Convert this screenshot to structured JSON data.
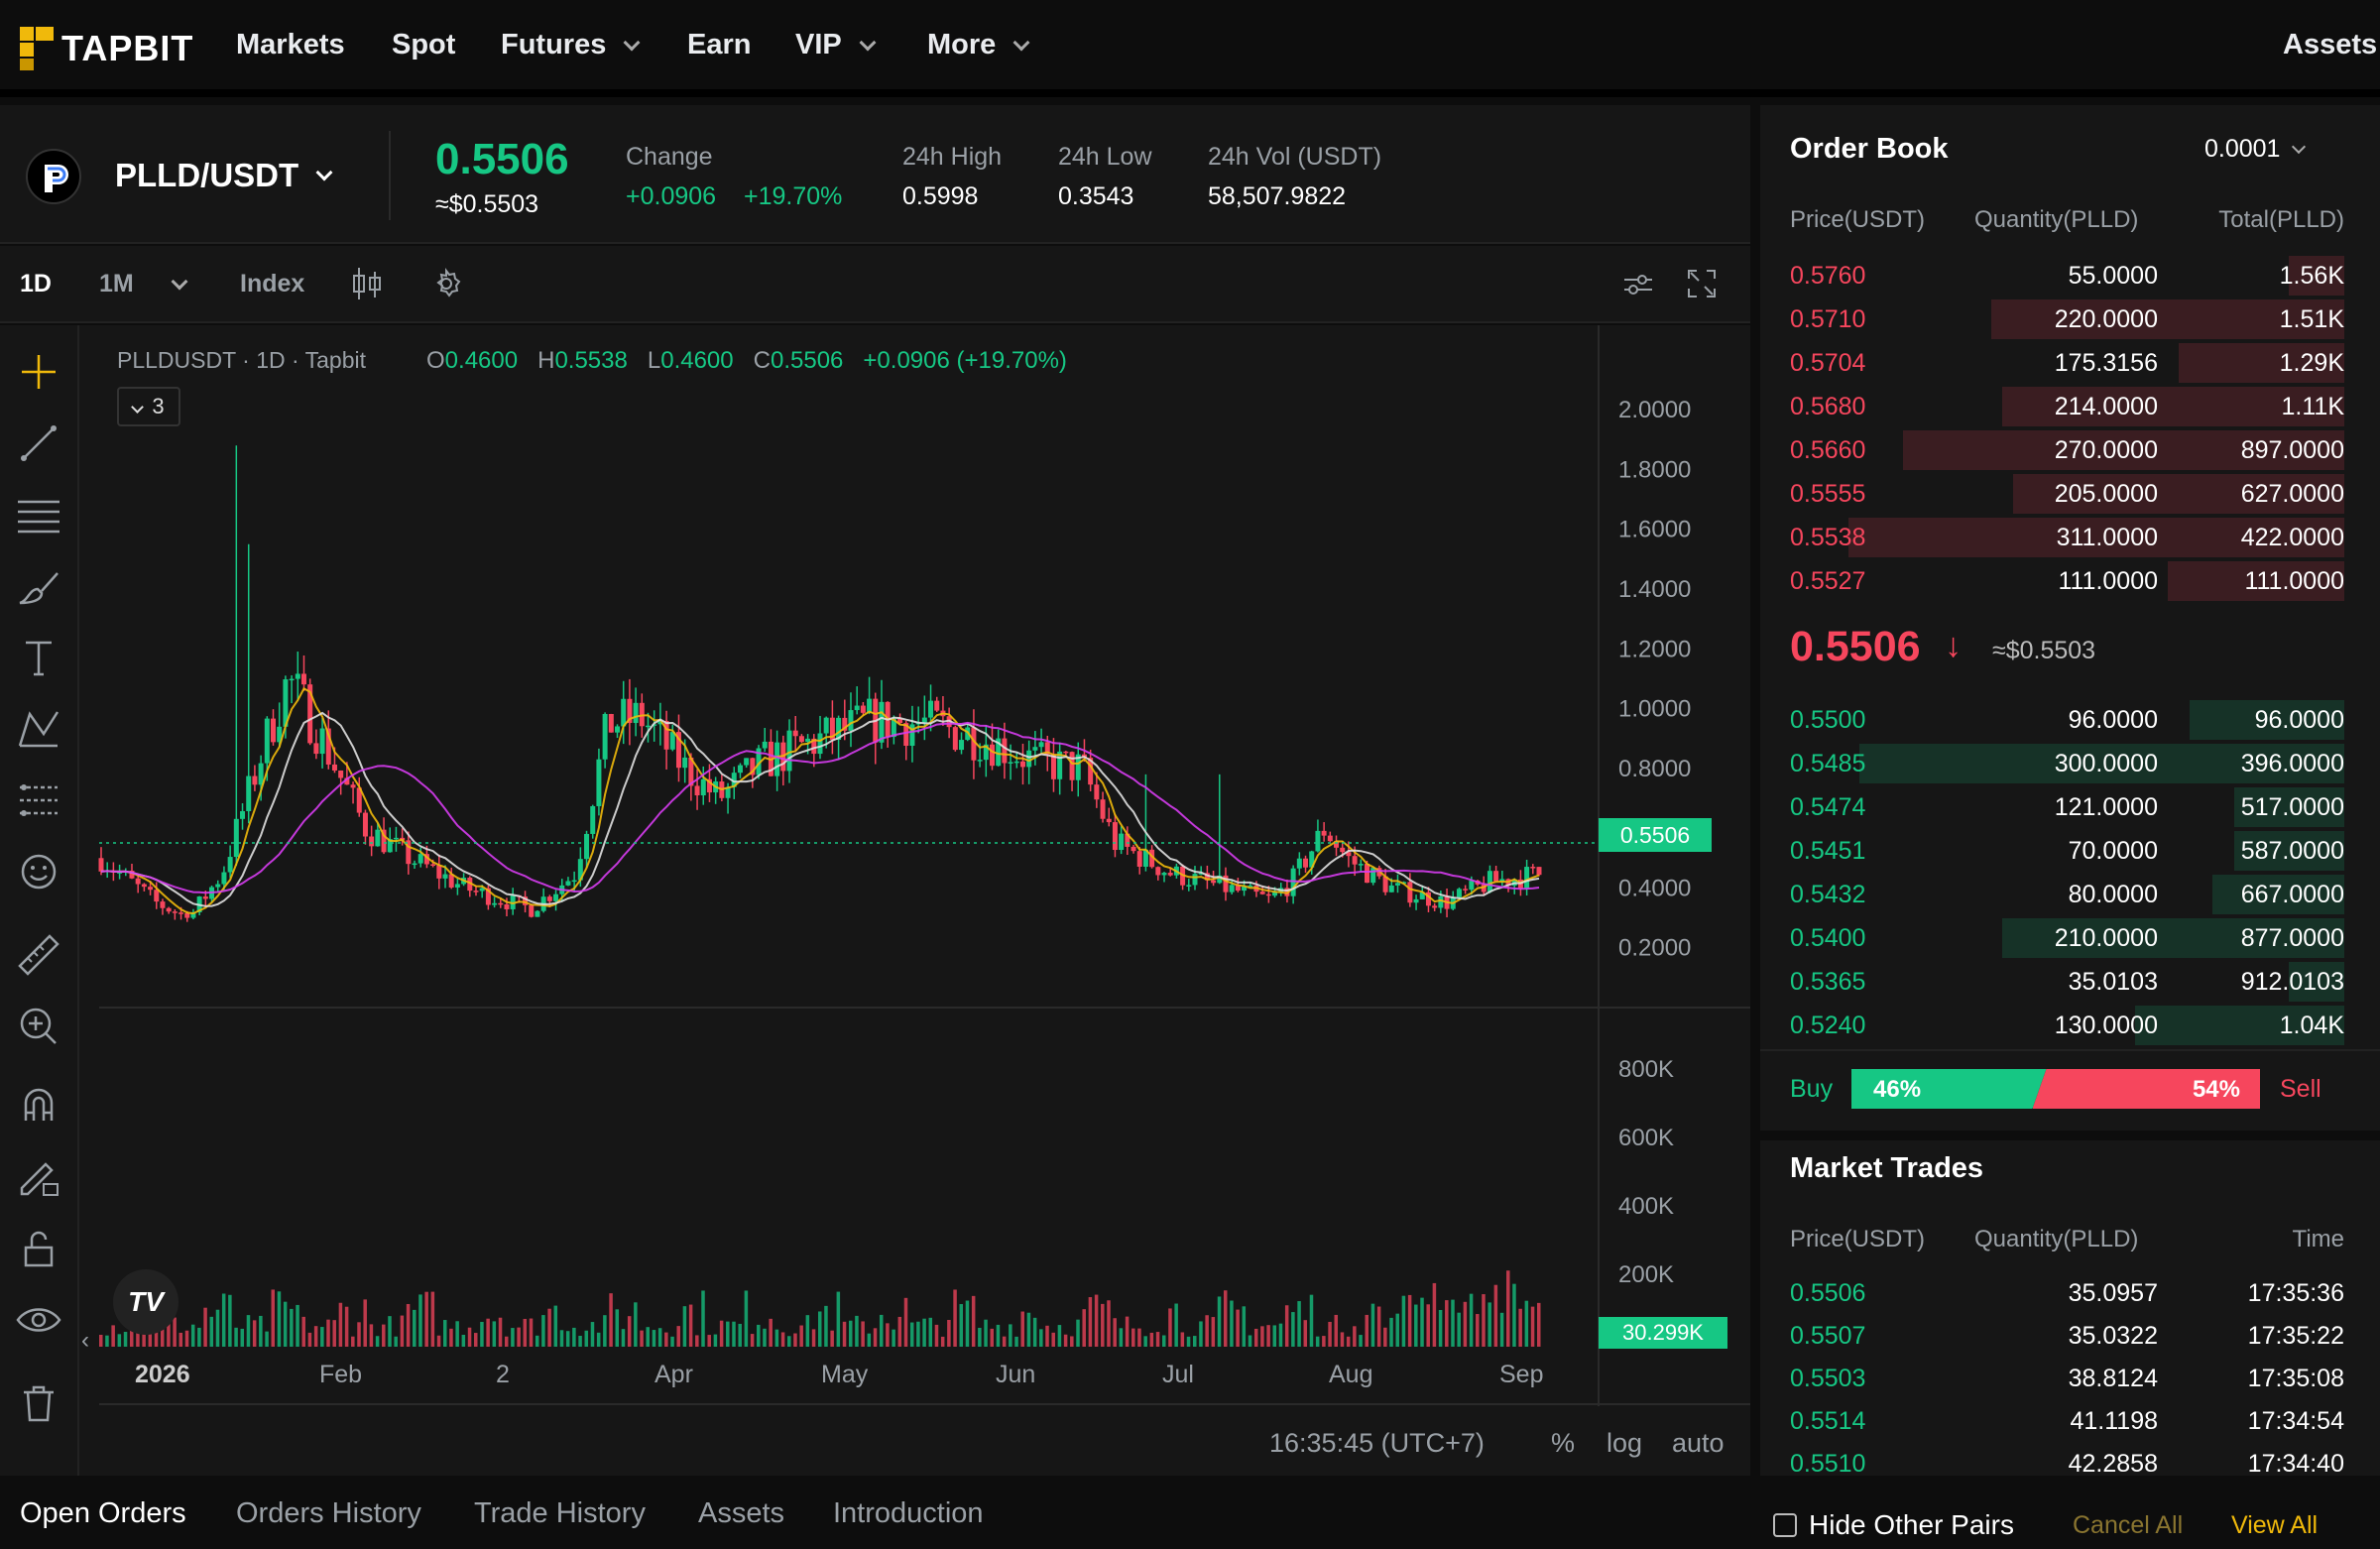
{
  "brand": {
    "name": "TAPBIT",
    "accent": "#f0b90b"
  },
  "nav": {
    "markets": "Markets",
    "spot": "Spot",
    "futures": "Futures",
    "earn": "Earn",
    "vip": "VIP",
    "more": "More",
    "assets": "Assets"
  },
  "ticker": {
    "pair": "PLLD/USDT",
    "price": "0.5506",
    "price_usd": "≈$0.5503",
    "change_label": "Change",
    "change_abs": "+0.0906",
    "change_pct": "+19.70%",
    "high_label": "24h High",
    "high": "0.5998",
    "low_label": "24h Low",
    "low": "0.3543",
    "vol_label": "24h Vol (USDT)",
    "vol": "58,507.9822"
  },
  "chart_toolbar": {
    "interval_1d": "1D",
    "interval_1m": "1M",
    "index": "Index"
  },
  "chart": {
    "symbol": "PLLDUSDT",
    "interval": "1D",
    "exchange": "Tapbit",
    "o_label": "O",
    "o": "0.4600",
    "h_label": "H",
    "h": "0.5538",
    "l_label": "L",
    "l": "0.4600",
    "c_label": "C",
    "c": "0.5506",
    "chg": "+0.0906 (+19.70%)",
    "indicators_count": "3",
    "price_axis": [
      "2.0000",
      "1.8000",
      "1.6000",
      "1.4000",
      "1.2000",
      "1.0000",
      "0.8000",
      "0.6000",
      "0.4000",
      "0.2000"
    ],
    "current_tag": "0.5506",
    "volume_axis": [
      "800K",
      "600K",
      "400K",
      "200K"
    ],
    "volume_tag": "30.299K",
    "time_axis": [
      "2026",
      "Feb",
      "2",
      "Apr",
      "May",
      "Jun",
      "Jul",
      "Aug",
      "Sep"
    ],
    "clock": "16:35:45 (UTC+7)",
    "pct": "%",
    "log": "log",
    "auto": "auto",
    "up_color": "#16c784",
    "down_color": "#f6465d"
  },
  "orderbook": {
    "title": "Order Book",
    "precision": "0.0001",
    "headers": [
      "Price(USDT)",
      "Quantity(PLLD)",
      "Total(PLLD)"
    ],
    "asks": [
      {
        "price": "0.5760",
        "qty": "55.0000",
        "total": "1.56K",
        "depth": 0.1
      },
      {
        "price": "0.5710",
        "qty": "220.0000",
        "total": "1.51K",
        "depth": 0.64
      },
      {
        "price": "0.5704",
        "qty": "175.3156",
        "total": "1.29K",
        "depth": 0.3
      },
      {
        "price": "0.5680",
        "qty": "214.0000",
        "total": "1.11K",
        "depth": 0.62
      },
      {
        "price": "0.5660",
        "qty": "270.0000",
        "total": "897.0000",
        "depth": 0.8
      },
      {
        "price": "0.5555",
        "qty": "205.0000",
        "total": "627.0000",
        "depth": 0.6
      },
      {
        "price": "0.5538",
        "qty": "311.0000",
        "total": "422.0000",
        "depth": 0.9
      },
      {
        "price": "0.5527",
        "qty": "111.0000",
        "total": "111.0000",
        "depth": 0.32
      }
    ],
    "last_price": "0.5506",
    "last_usd": "≈$0.5503",
    "bids": [
      {
        "price": "0.5500",
        "qty": "96.0000",
        "total": "96.0000",
        "depth": 0.28
      },
      {
        "price": "0.5485",
        "qty": "300.0000",
        "total": "396.0000",
        "depth": 0.88
      },
      {
        "price": "0.5474",
        "qty": "121.0000",
        "total": "517.0000",
        "depth": 0.2
      },
      {
        "price": "0.5451",
        "qty": "70.0000",
        "total": "587.0000",
        "depth": 0.2
      },
      {
        "price": "0.5432",
        "qty": "80.0000",
        "total": "667.0000",
        "depth": 0.24
      },
      {
        "price": "0.5400",
        "qty": "210.0000",
        "total": "877.0000",
        "depth": 0.62
      },
      {
        "price": "0.5365",
        "qty": "35.0103",
        "total": "912.0103",
        "depth": 0.1
      },
      {
        "price": "0.5240",
        "qty": "130.0000",
        "total": "1.04K",
        "depth": 0.38
      }
    ],
    "buy_label": "Buy",
    "buy_pct": "46%",
    "buy_ratio": 0.46,
    "sell_label": "Sell",
    "sell_pct": "54%"
  },
  "trades": {
    "title": "Market Trades",
    "headers": [
      "Price(USDT)",
      "Quantity(PLLD)",
      "Time"
    ],
    "rows": [
      {
        "price": "0.5506",
        "qty": "35.0957",
        "time": "17:35:36"
      },
      {
        "price": "0.5507",
        "qty": "35.0322",
        "time": "17:35:22"
      },
      {
        "price": "0.5503",
        "qty": "38.8124",
        "time": "17:35:08"
      },
      {
        "price": "0.5514",
        "qty": "41.1198",
        "time": "17:34:54"
      },
      {
        "price": "0.5510",
        "qty": "42.2858",
        "time": "17:34:40"
      }
    ]
  },
  "bottom": {
    "tabs": [
      "Open Orders",
      "Orders History",
      "Trade History",
      "Assets",
      "Introduction"
    ],
    "hide_pairs": "Hide Other Pairs",
    "cancel_all": "Cancel All",
    "view_all": "View All"
  }
}
